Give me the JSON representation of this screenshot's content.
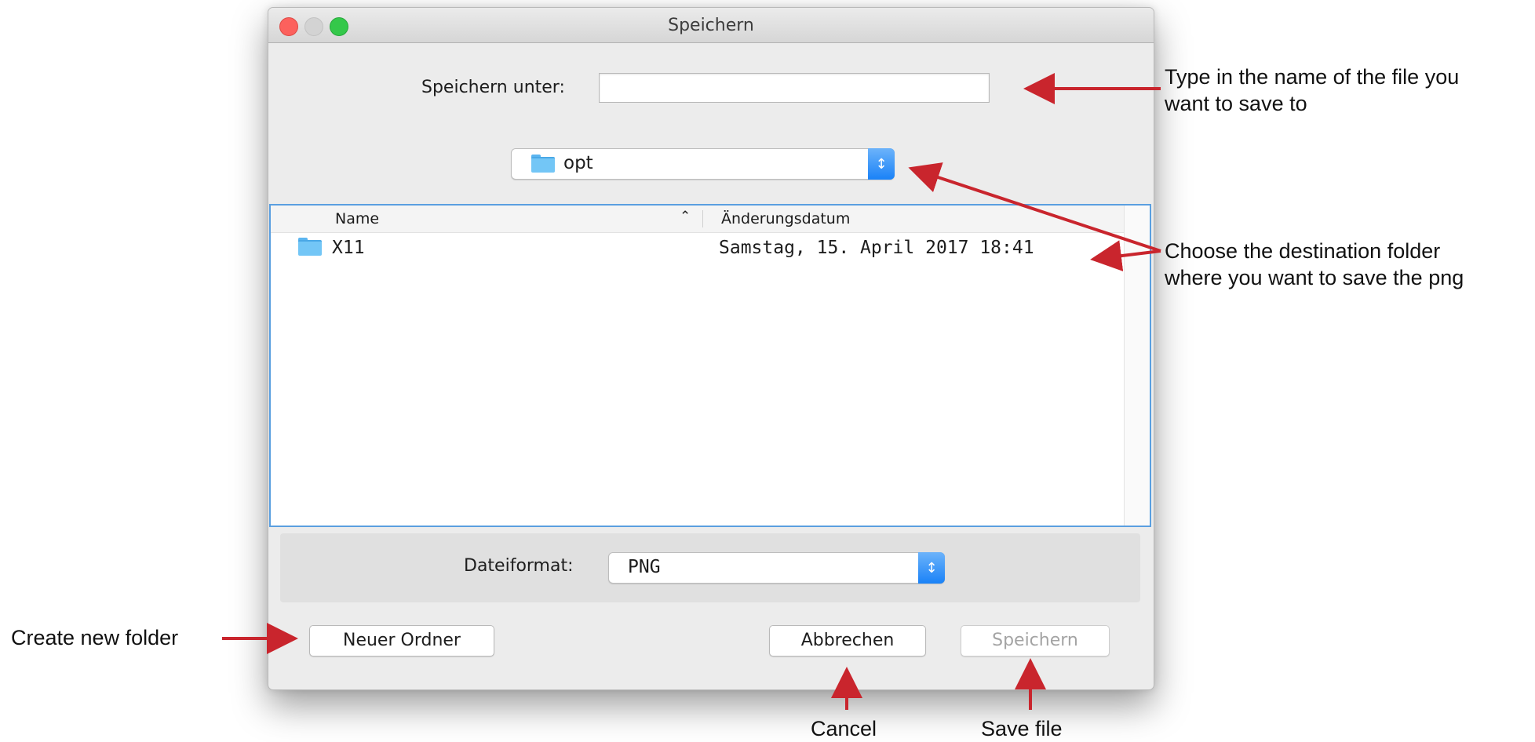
{
  "window": {
    "title": "Speichern"
  },
  "save_as": {
    "label": "Speichern unter:",
    "value": ""
  },
  "location": {
    "folder": "opt",
    "folder_icon": "folder-icon",
    "stepper_icon": "up-down-chevron-icon"
  },
  "file_list": {
    "columns": [
      {
        "label": "Name",
        "sort": "ascending"
      },
      {
        "label": "Änderungsdatum"
      }
    ],
    "rows": [
      {
        "icon": "folder-icon",
        "name": "X11",
        "modified": "Samstag, 15. April 2017 18:41"
      }
    ]
  },
  "format": {
    "label": "Dateiformat:",
    "selected": "PNG"
  },
  "buttons": {
    "new_folder": "Neuer Ordner",
    "cancel": "Abbrechen",
    "save": "Speichern"
  },
  "annotations": {
    "filename_line1": "Type in the name of the file you",
    "filename_line2": "want to save to",
    "folder_line1": "Choose the destination folder",
    "folder_line2": "where you want to save the png",
    "new_folder": "Create new folder",
    "cancel": "Cancel",
    "save": "Save file",
    "arrow_color": "#c9252d"
  },
  "colors": {
    "accent": "#1a82f7",
    "close": "#fc615d",
    "minimize": "#d3d3d3",
    "zoom": "#34c84a"
  }
}
